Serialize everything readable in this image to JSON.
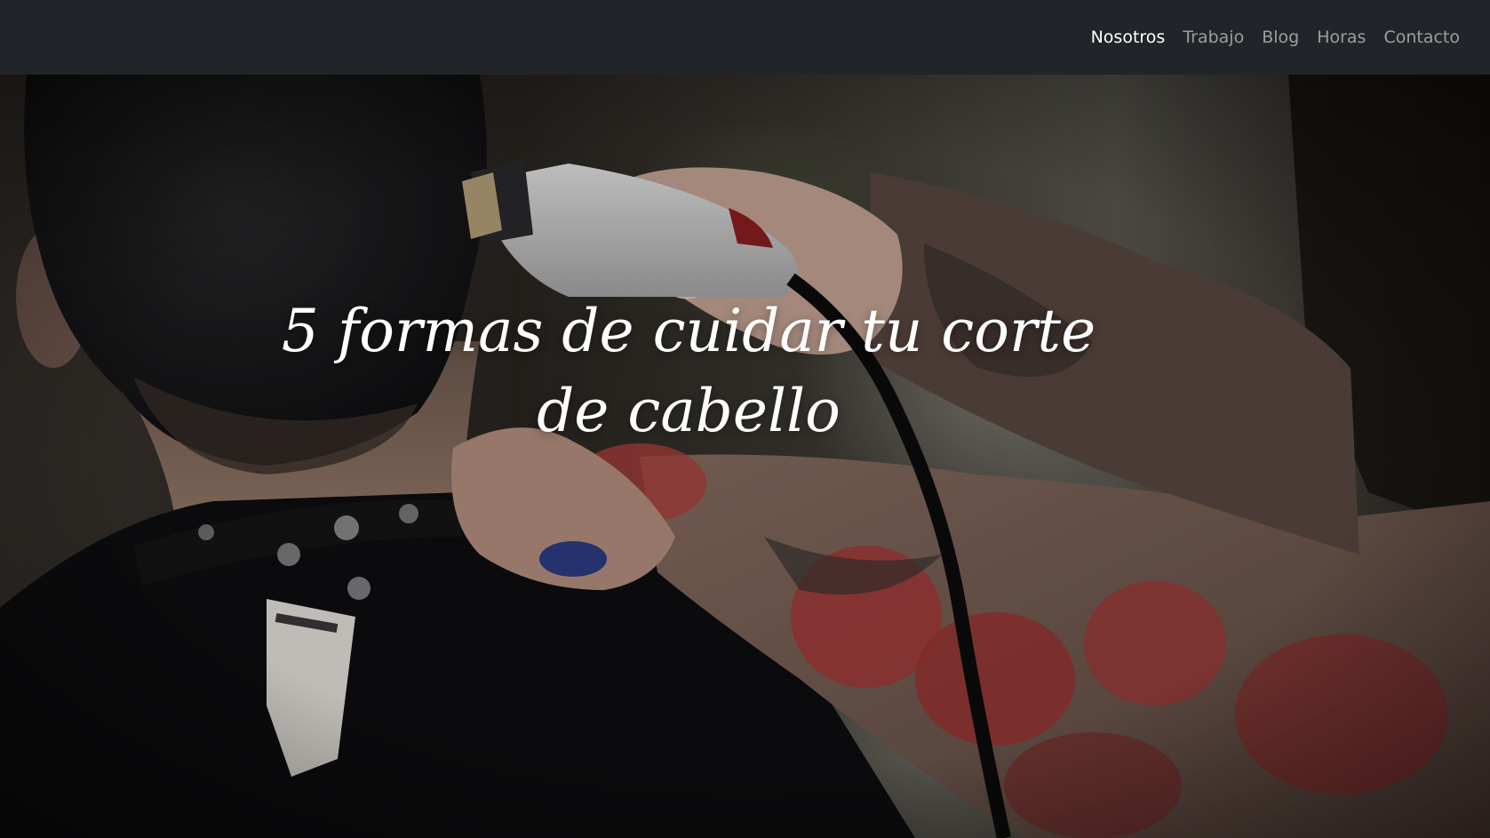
{
  "nav": {
    "items": [
      {
        "label": "Nosotros",
        "active": true
      },
      {
        "label": "Trabajo",
        "active": false
      },
      {
        "label": "Blog",
        "active": false
      },
      {
        "label": "Horas",
        "active": false
      },
      {
        "label": "Contacto",
        "active": false
      }
    ]
  },
  "hero": {
    "title": "5 formas de cuidar tu corte de cabello"
  },
  "colors": {
    "navbar_bg": "#212529",
    "nav_active": "#ffffff",
    "nav_inactive": "#8c8f93",
    "title": "#ffffff"
  }
}
